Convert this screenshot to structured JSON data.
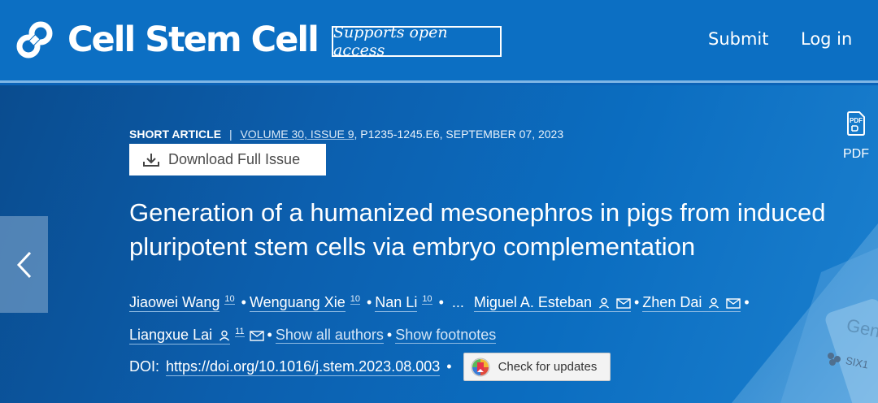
{
  "header": {
    "journal_name": "Cell Stem Cell",
    "open_access_badge": "Supports open access",
    "nav": {
      "submit": "Submit",
      "login": "Log in"
    }
  },
  "article": {
    "type": "SHORT ARTICLE",
    "separator": "|",
    "volume": "VOLUME 30, ISSUE 9",
    "pages_date": ", P1235-1245.E6, SEPTEMBER 07, 2023",
    "download_label": "Download Full Issue",
    "pdf_label": "PDF",
    "title": "Generation of a humanized mesonephros in pigs from induced pluripotent stem cells via embryo complementation",
    "authors": [
      {
        "name": "Jiaowei Wang",
        "sup": "10"
      },
      {
        "name": "Wenguang Xie",
        "sup": "10"
      },
      {
        "name": "Nan Li",
        "sup": "10"
      },
      {
        "name": "Miguel A. Esteban"
      },
      {
        "name": "Zhen Dai"
      },
      {
        "name": "Liangxue Lai",
        "sup": "11"
      }
    ],
    "ellipsis": "...",
    "show_all_authors": "Show all authors",
    "show_footnotes": "Show footnotes",
    "doi_label": "DOI:",
    "doi_url": "https://doi.org/10.1016/j.stem.2023.08.003",
    "check_updates": "Check for updates",
    "cover_text_1": "Gen",
    "cover_text_2": "SIX1"
  },
  "colors": {
    "header_bg": "#0c6fc3",
    "hero_bg": "#0b63b8",
    "accent_underline": "#8fbbe3"
  }
}
